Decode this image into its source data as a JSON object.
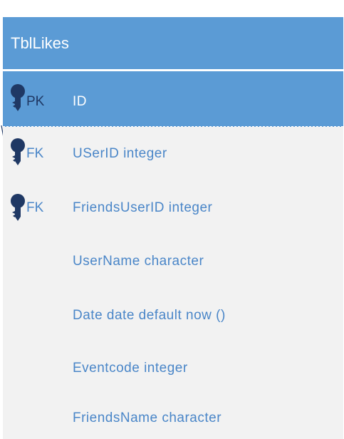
{
  "table": {
    "title": "TblLikes",
    "primary_key": {
      "badge": "PK",
      "field": "ID"
    },
    "rows": [
      {
        "badge": "FK",
        "field": "USerID integer"
      },
      {
        "badge": "FK",
        "field": "FriendsUserID integer"
      },
      {
        "badge": "",
        "field": "UserName character"
      },
      {
        "badge": "",
        "field": "Date date default now ()"
      },
      {
        "badge": "",
        "field": "Eventcode integer"
      },
      {
        "badge": "",
        "field": "FriendsName character"
      }
    ]
  },
  "colors": {
    "header": "#5b9bd5",
    "body": "#f2f2f2",
    "field_text": "#4a86c8",
    "key_icon": "#1f3864"
  },
  "icons": {
    "key": "key-icon",
    "connector": "relationship-connector"
  }
}
